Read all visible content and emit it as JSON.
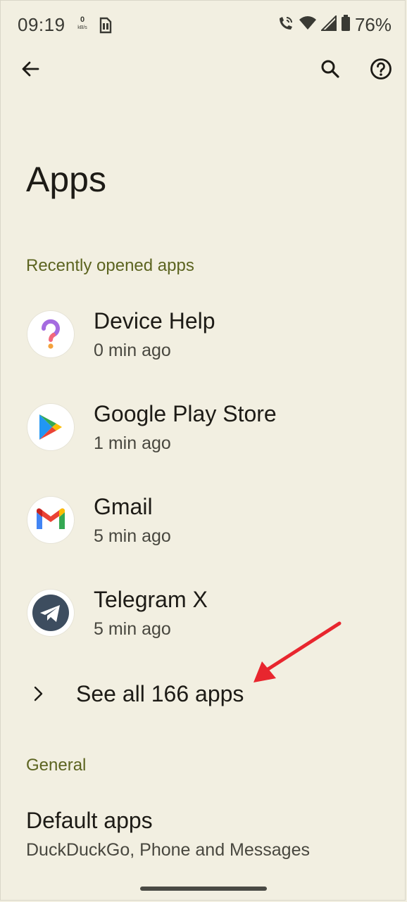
{
  "status_bar": {
    "time": "09:19",
    "net_speed_value": "0",
    "net_speed_unit": "kB/s",
    "battery_percent": "76%"
  },
  "app_bar": {
    "back_icon": "arrow-back-icon",
    "search_icon": "search-icon",
    "help_icon": "help-icon"
  },
  "page": {
    "title": "Apps"
  },
  "recent": {
    "header": "Recently opened apps",
    "apps": [
      {
        "name": "Device Help",
        "time": "0 min ago",
        "icon": "device-help-icon"
      },
      {
        "name": "Google Play Store",
        "time": "1 min ago",
        "icon": "google-play-store-icon"
      },
      {
        "name": "Gmail",
        "time": "5 min ago",
        "icon": "gmail-icon"
      },
      {
        "name": "Telegram X",
        "time": "5 min ago",
        "icon": "telegram-x-icon"
      }
    ],
    "see_all": "See all 166 apps"
  },
  "general": {
    "header": "General",
    "default_apps": {
      "title": "Default apps",
      "subtitle": "DuckDuckGo, Phone and Messages"
    }
  },
  "colors": {
    "background": "#f2efe1",
    "section_header": "#5c6420",
    "annotation_arrow": "#e8262e"
  }
}
